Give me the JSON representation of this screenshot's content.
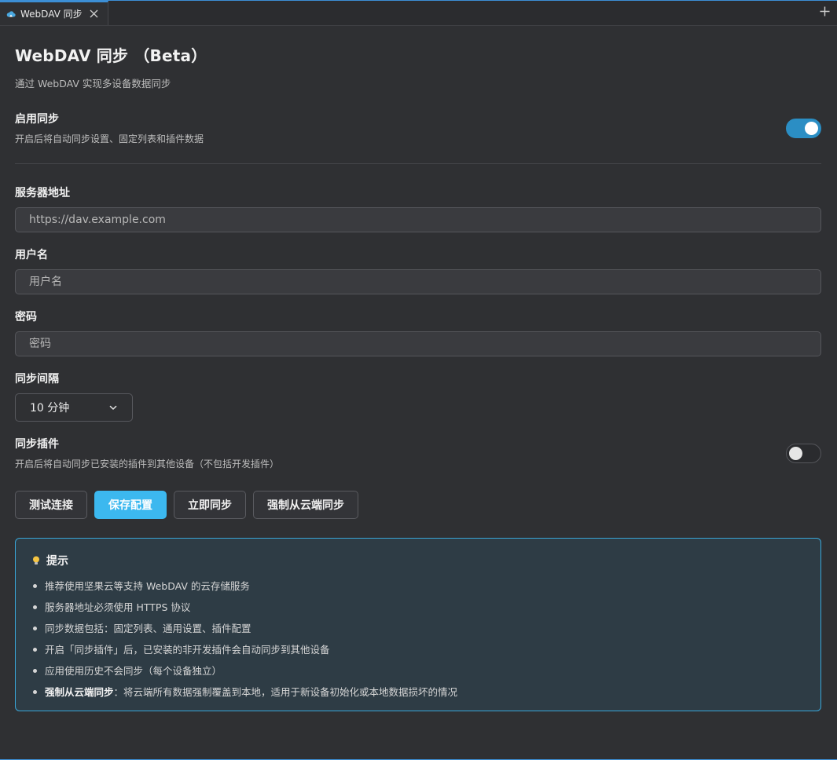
{
  "tab": {
    "title": "WebDAV 同步",
    "icon": "cloud-icon"
  },
  "header": {
    "title": "WebDAV 同步 （Beta）",
    "subtitle": "通过 WebDAV 实现多设备数据同步"
  },
  "enable_sync": {
    "title": "启用同步",
    "description": "开启后将自动同步设置、固定列表和插件数据",
    "on": true
  },
  "server": {
    "label": "服务器地址",
    "placeholder": "https://dav.example.com"
  },
  "username": {
    "label": "用户名",
    "placeholder": "用户名"
  },
  "password": {
    "label": "密码",
    "placeholder": "密码"
  },
  "interval": {
    "label": "同步间隔",
    "value": "10 分钟"
  },
  "sync_plugins": {
    "title": "同步插件",
    "description": "开启后将自动同步已安装的插件到其他设备（不包括开发插件）",
    "on": false
  },
  "buttons": {
    "test": "测试连接",
    "save": "保存配置",
    "sync_now": "立即同步",
    "force_cloud": "强制从云端同步"
  },
  "tips": {
    "title": "提示",
    "items": [
      "推荐使用坚果云等支持 WebDAV 的云存储服务",
      "服务器地址必须使用 HTTPS 协议",
      "同步数据包括：固定列表、通用设置、插件配置",
      "开启「同步插件」后，已安装的非开发插件会自动同步到其他设备",
      "应用使用历史不会同步（每个设备独立）"
    ],
    "last_bold": "强制从云端同步",
    "last_rest": "：将云端所有数据强制覆盖到本地，适用于新设备初始化或本地数据损坏的情况"
  },
  "colors": {
    "accent": "#3cb8ef",
    "toggle_on": "#2b8ec4",
    "tips_border": "#3aa6d8"
  }
}
